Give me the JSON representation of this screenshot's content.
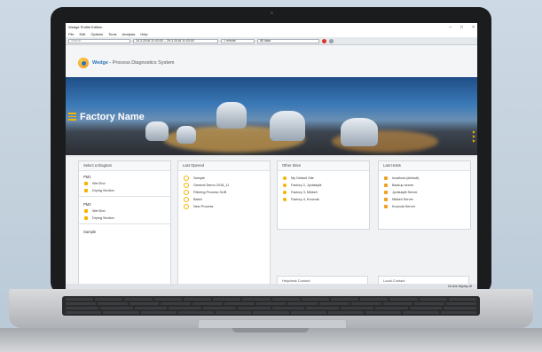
{
  "window": {
    "title": "Wedge Profile Edition",
    "controls": [
      "–",
      "□",
      "×"
    ]
  },
  "menu": [
    "File",
    "Edit",
    "Options",
    "Tools",
    "Analysis",
    "Help"
  ],
  "toolbar": {
    "search_placeholder": "Search",
    "date_range": "24.3.2018 11:03:00 -- 29.3.2018 11:03:00",
    "interval": "1 minute",
    "filter": "All data"
  },
  "header": {
    "brand": "Wedge",
    "subtitle": "- Process Diagnostics System"
  },
  "hero": {
    "title": "Factory Name"
  },
  "diagram_card": {
    "title": "Select a Diagram",
    "groups": [
      {
        "name": "PM1",
        "items": [
          "Wet End",
          "Drying Section"
        ]
      },
      {
        "name": "PM2",
        "items": [
          "Wet End",
          "Drying Section"
        ]
      },
      {
        "name": "Sample",
        "items": []
      }
    ]
  },
  "last_opened": {
    "title": "Last Opened",
    "items": [
      "Sample",
      "General Demo 2018_11",
      "Filtering Process SUB",
      "Batch",
      "New Process"
    ]
  },
  "other_sites": {
    "title": "Other Sites",
    "items": [
      "My Default Site",
      "Factory 2, Jyväskylä",
      "Factory 3, Mikkeli",
      "Factory 4, Kouvola"
    ]
  },
  "last_hosts": {
    "title": "Last Hosts",
    "items": [
      "localhost (default)",
      "Backup server",
      "Jyväskylä Server",
      "Mikkeli Server",
      "Kouvola Server"
    ]
  },
  "bottom_cards": {
    "helpdesk": "Helpdesk Contact",
    "local": "Local Contact"
  },
  "status": {
    "text": "On-line display off"
  },
  "colors": {
    "accent": "#f4b400",
    "brand_blue": "#2a74b8",
    "site_icon": "#f4b400",
    "host_icon": "#f0a020"
  }
}
